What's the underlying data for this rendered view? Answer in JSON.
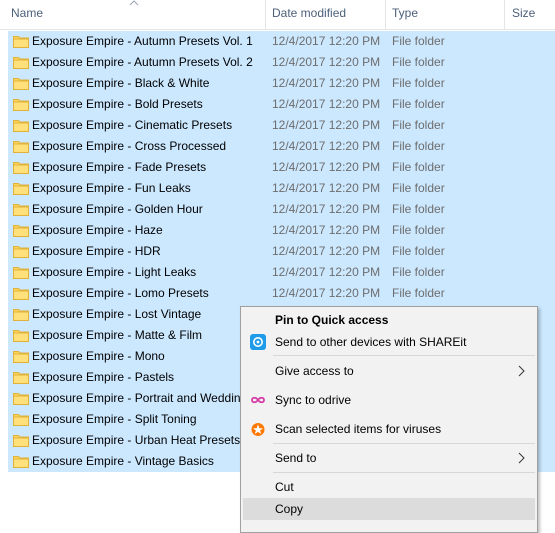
{
  "columns": {
    "name": "Name",
    "date_modified": "Date modified",
    "type": "Type",
    "size": "Size"
  },
  "files": [
    {
      "name": "Exposure Empire - Autumn Presets Vol. 1",
      "date": "12/4/2017 12:20 PM",
      "type": "File folder"
    },
    {
      "name": "Exposure Empire - Autumn Presets Vol. 2",
      "date": "12/4/2017 12:20 PM",
      "type": "File folder"
    },
    {
      "name": "Exposure Empire - Black & White",
      "date": "12/4/2017 12:20 PM",
      "type": "File folder"
    },
    {
      "name": "Exposure Empire - Bold Presets",
      "date": "12/4/2017 12:20 PM",
      "type": "File folder"
    },
    {
      "name": "Exposure Empire - Cinematic Presets",
      "date": "12/4/2017 12:20 PM",
      "type": "File folder"
    },
    {
      "name": "Exposure Empire - Cross Processed",
      "date": "12/4/2017 12:20 PM",
      "type": "File folder"
    },
    {
      "name": "Exposure Empire - Fade Presets",
      "date": "12/4/2017 12:20 PM",
      "type": "File folder"
    },
    {
      "name": "Exposure Empire - Fun Leaks",
      "date": "12/4/2017 12:20 PM",
      "type": "File folder"
    },
    {
      "name": "Exposure Empire - Golden Hour",
      "date": "12/4/2017 12:20 PM",
      "type": "File folder"
    },
    {
      "name": "Exposure Empire - Haze",
      "date": "12/4/2017 12:20 PM",
      "type": "File folder"
    },
    {
      "name": "Exposure Empire - HDR",
      "date": "12/4/2017 12:20 PM",
      "type": "File folder"
    },
    {
      "name": "Exposure Empire - Light Leaks",
      "date": "12/4/2017 12:20 PM",
      "type": "File folder"
    },
    {
      "name": "Exposure Empire - Lomo Presets",
      "date": "12/4/2017 12:20 PM",
      "type": "File folder"
    },
    {
      "name": "Exposure Empire - Lost Vintage",
      "date": "",
      "type": ""
    },
    {
      "name": "Exposure Empire - Matte & Film",
      "date": "",
      "type": ""
    },
    {
      "name": "Exposure Empire - Mono",
      "date": "",
      "type": ""
    },
    {
      "name": "Exposure Empire - Pastels",
      "date": "",
      "type": ""
    },
    {
      "name": "Exposure Empire - Portrait and Wedding",
      "date": "",
      "type": ""
    },
    {
      "name": "Exposure Empire - Split Toning",
      "date": "",
      "type": ""
    },
    {
      "name": "Exposure Empire - Urban Heat Presets",
      "date": "",
      "type": ""
    },
    {
      "name": "Exposure Empire - Vintage Basics",
      "date": "",
      "type": ""
    }
  ],
  "colors": {
    "selection": "#cce8ff",
    "folder": "#ffd65c",
    "menu_bg": "#f2f2f2",
    "menu_hover": "#dcdcdc"
  },
  "context_menu": {
    "pin": "Pin to Quick access",
    "shareit": "Send to other devices with SHAREit",
    "give_access": "Give access to",
    "sync": "Sync to odrive",
    "scan": "Scan selected items for viruses",
    "send_to": "Send to",
    "cut": "Cut",
    "copy": "Copy",
    "hovered_item": "Copy"
  }
}
